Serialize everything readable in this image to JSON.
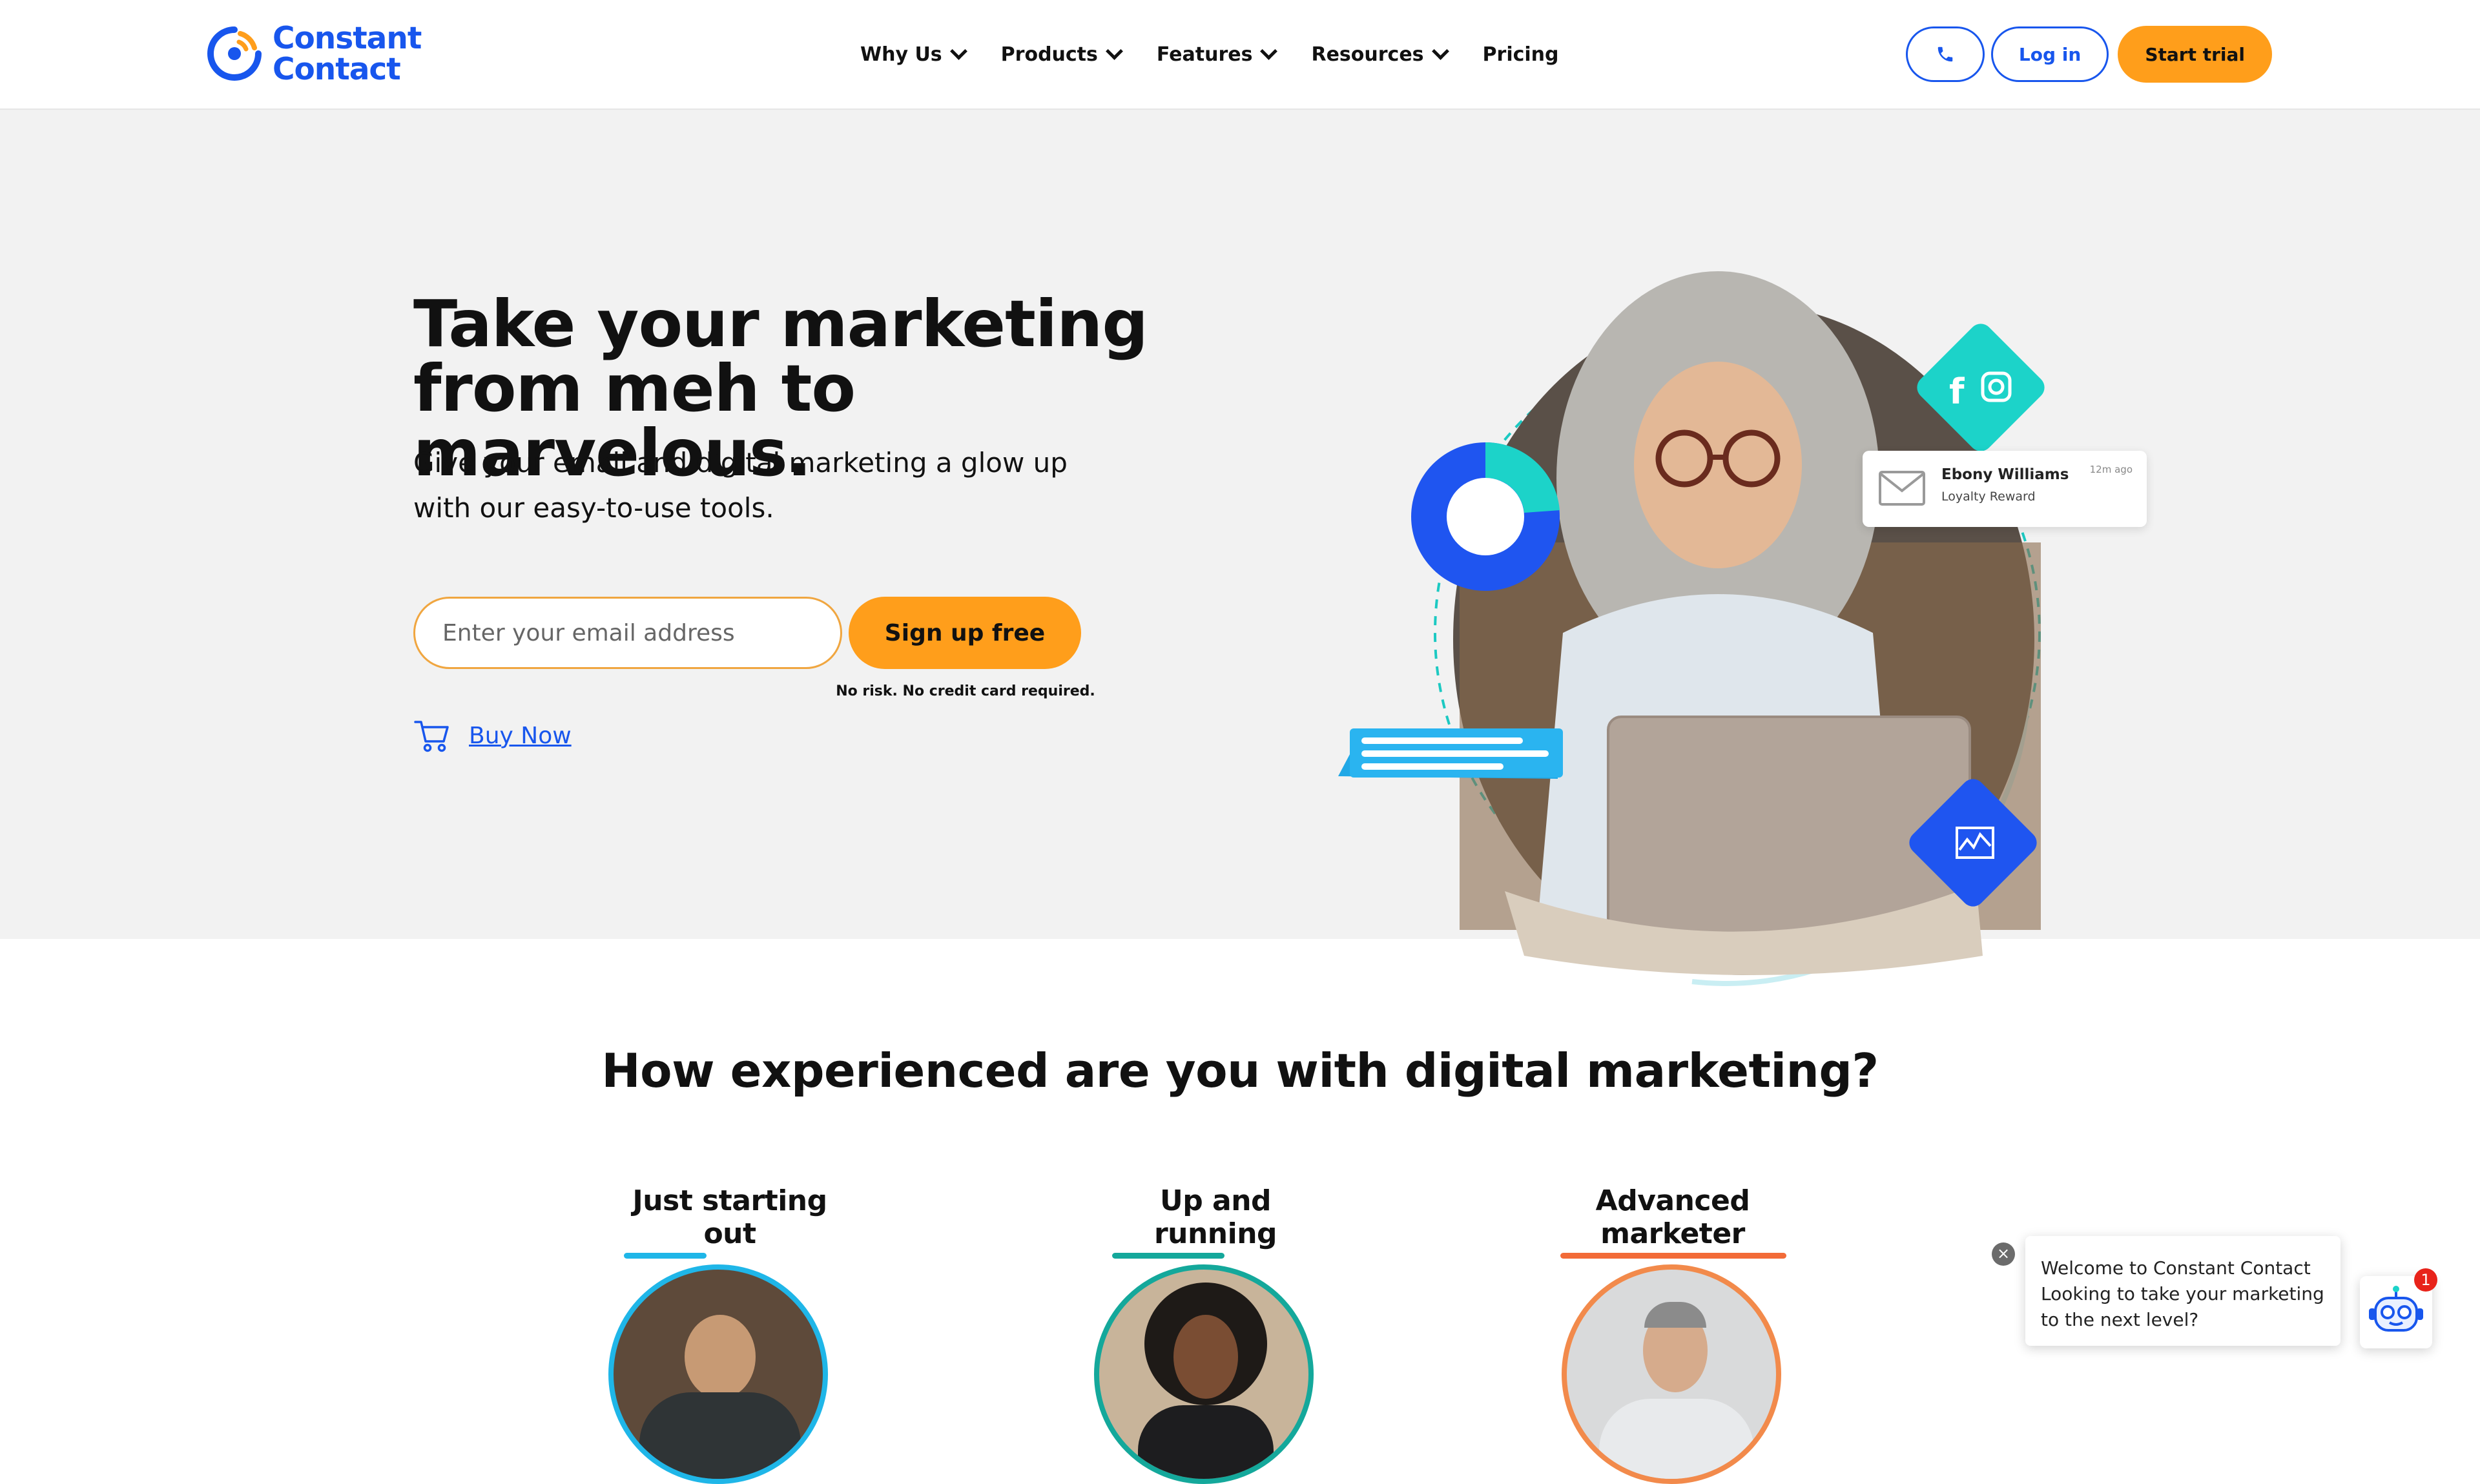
{
  "header": {
    "logo_line1": "Constant",
    "logo_line2": "Contact",
    "nav": [
      {
        "label": "Why Us",
        "has_dropdown": true
      },
      {
        "label": "Products",
        "has_dropdown": true
      },
      {
        "label": "Features",
        "has_dropdown": true
      },
      {
        "label": "Resources",
        "has_dropdown": true
      },
      {
        "label": "Pricing",
        "has_dropdown": false
      }
    ],
    "phone_icon": "phone-icon",
    "login_label": "Log in",
    "trial_label": "Start trial"
  },
  "hero": {
    "title_line1": "Take your marketing",
    "title_line2": "from meh to marvelous.",
    "subtitle_line1": "Give your email and digital marketing a glow up",
    "subtitle_line2": "with our easy-to-use tools.",
    "email_placeholder": "Enter your email address",
    "signup_label": "Sign up free",
    "no_risk": "No risk. No credit card required.",
    "buy_now": "Buy Now",
    "notification": {
      "name": "Ebony Williams",
      "subtitle": "Loyalty Reward",
      "time": "12m ago"
    }
  },
  "experience": {
    "title": "How experienced are you with digital marketing?",
    "levels": [
      {
        "label": "Just starting out",
        "color": "#1fb6e8"
      },
      {
        "label": "Up and running",
        "color": "#14a89b"
      },
      {
        "label": "Advanced marketer",
        "color": "#f26b38"
      }
    ]
  },
  "chat": {
    "line1": "Welcome to Constant Contact ",
    "line2": "Looking to take your marketing",
    "line3": "to the next level?",
    "badge": "1",
    "close": "×"
  },
  "colors": {
    "brand_blue": "#1856ed",
    "orange": "#ff9e1b",
    "teal": "#1cd3c9",
    "hero_bg": "#f2f2f2"
  }
}
